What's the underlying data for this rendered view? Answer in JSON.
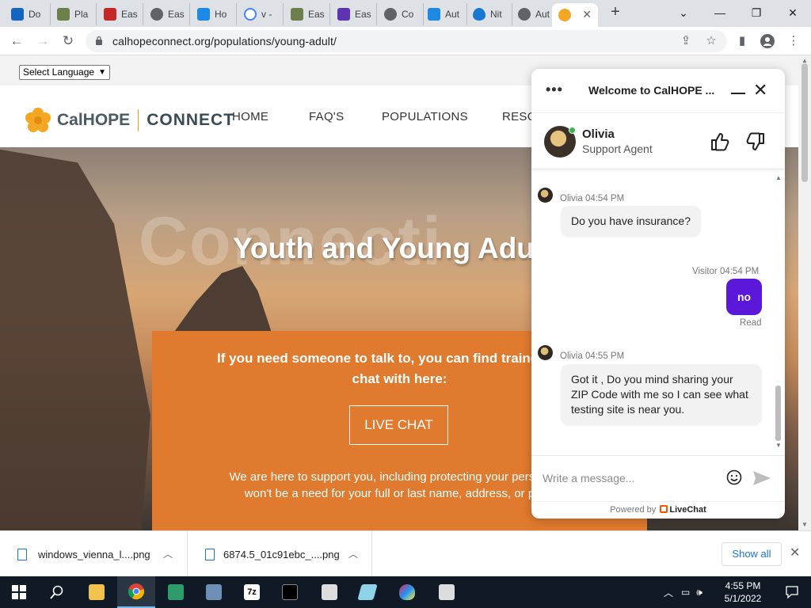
{
  "browser": {
    "tabs": [
      {
        "label": "Do",
        "color": "#1565c0"
      },
      {
        "label": "Pla",
        "color": "#6d7f4a"
      },
      {
        "label": "Eas",
        "color": "#c62828"
      },
      {
        "label": "Eas",
        "color": "#5f6368"
      },
      {
        "label": "Ho",
        "color": "#1e88e5"
      },
      {
        "label": "v -",
        "color": "#4285f4"
      },
      {
        "label": "Eas",
        "color": "#6d7f4a"
      },
      {
        "label": "Eas",
        "color": "#5e35b1"
      },
      {
        "label": "Co",
        "color": "#5f6368"
      },
      {
        "label": "Aut",
        "color": "#1e88e5"
      },
      {
        "label": "Nit",
        "color": "#1976d2"
      },
      {
        "label": "Aut",
        "color": "#5f6368"
      }
    ],
    "active_tab_color": "#f5a623",
    "url": "calhopeconnect.org/populations/young-adult/"
  },
  "page": {
    "language_select": "Select Language",
    "logo_brand": "CalHOPE",
    "logo_brand2": "CONNECT",
    "nav": [
      "HOME",
      "FAQ'S",
      "POPULATIONS",
      "RESO"
    ],
    "hero_watermark": "Connecti",
    "hero_title": "Youth and Young Adu",
    "box_text_line1": "If you need someone to talk to, you can find trained supp",
    "box_text_line2": "chat with here:",
    "live_chat_button": "LIVE CHAT",
    "box_sub_line1": "We are here to support you, including protecting your personal in",
    "box_sub_line2": "won't be a need for your full or last name, address, or phon"
  },
  "chat": {
    "title": "Welcome to CalHOPE ...",
    "agent_name": "Olivia",
    "agent_role": "Support Agent",
    "messages": [
      {
        "meta": "Olivia 04:54 PM",
        "text": "Do you have insurance?"
      },
      {
        "meta": "Visitor 04:54 PM",
        "text": "no",
        "status": "Read"
      },
      {
        "meta": "Olivia 04:55 PM",
        "text": "Got it , Do you mind sharing your ZIP Code with me so I can see what testing site is near you."
      }
    ],
    "composer_placeholder": "Write a message...",
    "powered_by": "Powered by",
    "powered_brand": "LiveChat",
    "accent_color": "#5b18d9"
  },
  "downloads": {
    "items": [
      "windows_vienna_l....png",
      "6874.5_01c91ebc_....png"
    ],
    "show_all": "Show all"
  },
  "taskbar": {
    "time": "4:55 PM",
    "date": "5/1/2022"
  }
}
